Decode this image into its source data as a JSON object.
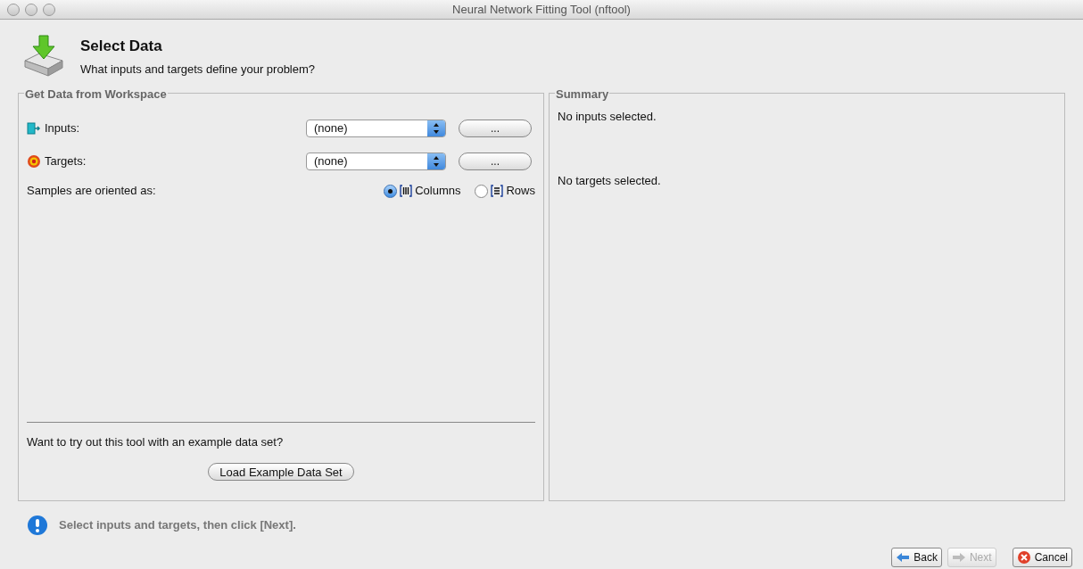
{
  "window": {
    "title": "Neural Network Fitting Tool (nftool)"
  },
  "header": {
    "title": "Select Data",
    "subtitle": "What inputs and targets define your problem?"
  },
  "workspace": {
    "title": "Get Data from Workspace",
    "rows": [
      {
        "kind": "inputs",
        "label": "Inputs:",
        "value": "(none)",
        "browse": "..."
      },
      {
        "kind": "targets",
        "label": "Targets:",
        "value": "(none)",
        "browse": "..."
      }
    ],
    "orientation": {
      "label": "Samples are oriented as:",
      "options": [
        {
          "kind": "columns",
          "label": "Columns",
          "selected": true
        },
        {
          "kind": "rows",
          "label": "Rows",
          "selected": false
        }
      ]
    },
    "example_prompt": "Want to try out this tool with an example data set?",
    "example_button": "Load Example Data Set"
  },
  "summary": {
    "title": "Summary",
    "lines": [
      "No inputs selected.",
      "No targets selected."
    ]
  },
  "status": "Select inputs and targets, then click [Next].",
  "buttons": [
    {
      "kind": "back",
      "label": "Back",
      "disabled": false
    },
    {
      "kind": "next",
      "label": "Next",
      "disabled": true
    },
    {
      "kind": "cancel",
      "label": "Cancel",
      "disabled": false
    }
  ]
}
